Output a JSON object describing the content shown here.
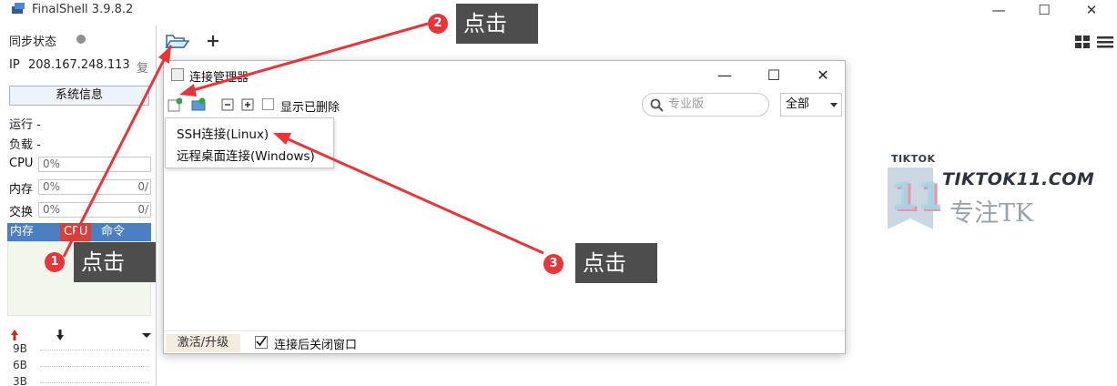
{
  "window": {
    "title": "FinalShell 3.9.8.2",
    "minimize_glyph": "—",
    "maximize_glyph": "☐",
    "close_glyph": "✕"
  },
  "sidebar": {
    "sync_status": "同步状态",
    "ip_label": "IP",
    "ip_value": "208.167.248.113",
    "copy_label": "复",
    "sysinfo_button": "系统信息",
    "run_label": "运行 -",
    "load_label": "负载 -",
    "meters": [
      {
        "label": "CPU",
        "value": "0%",
        "right": ""
      },
      {
        "label": "内存",
        "value": "0%",
        "right": "0/"
      },
      {
        "label": "交换",
        "value": "0%",
        "right": "0/"
      }
    ],
    "process_tabs": [
      "内存",
      "CPU",
      "命令"
    ],
    "net_values": [
      "9B",
      "6B",
      "3B"
    ]
  },
  "dialog": {
    "title": "连接管理器",
    "show_deleted_label": "显示已删除",
    "search_placeholder": "专业版",
    "filter_value": "全部",
    "menu_items": [
      "SSH连接(Linux)",
      "远程桌面连接(Windows)"
    ],
    "activate_label": "激活/升级",
    "close_after_connect_label": "连接后关闭窗口",
    "close_after_connect_checked": true
  },
  "watermark": {
    "small_text": "TIKTOK",
    "brand": "TIKTOK11.COM",
    "slogan": "专注TK",
    "logo_number": "11"
  },
  "annotations": [
    {
      "number": "1",
      "text": "点击"
    },
    {
      "number": "2",
      "text": "点击"
    },
    {
      "number": "3",
      "text": "点击"
    }
  ],
  "colors": {
    "accent_red": "#e8353a",
    "callout_bg": "#4d4d4d",
    "process_header": "#4a7fc1",
    "cpu_tab": "#d9403a"
  }
}
